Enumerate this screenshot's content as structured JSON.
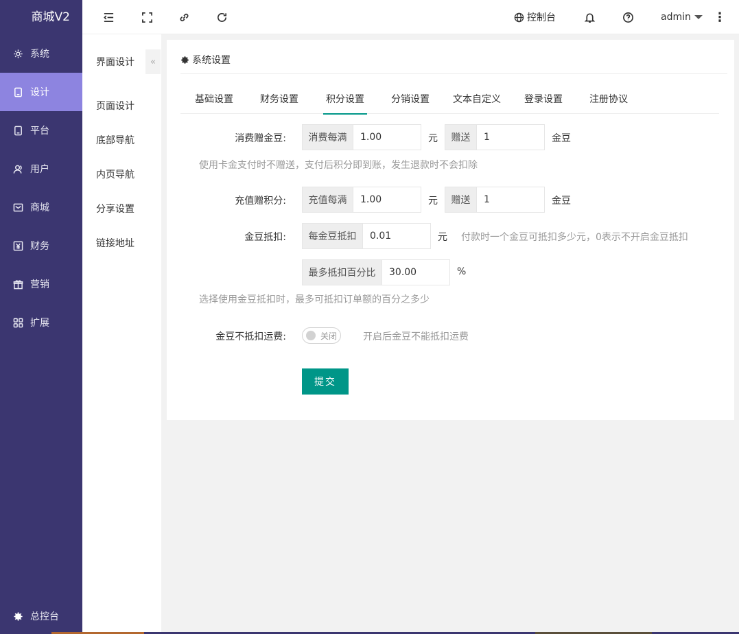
{
  "app": {
    "title": "商城V2"
  },
  "sidebar": {
    "items": [
      {
        "label": "系统",
        "icon": "gear-icon"
      },
      {
        "label": "设计",
        "icon": "tablet-icon",
        "active": true
      },
      {
        "label": "平台",
        "icon": "tablet-icon"
      },
      {
        "label": "用户",
        "icon": "user-icon"
      },
      {
        "label": "商城",
        "icon": "mail-icon"
      },
      {
        "label": "财务",
        "icon": "yen-icon"
      },
      {
        "label": "营销",
        "icon": "gift-icon"
      },
      {
        "label": "扩展",
        "icon": "grid-icon"
      }
    ],
    "bottom": {
      "label": "总控台",
      "icon": "gear-icon"
    }
  },
  "topbar": {
    "console_label": "控制台",
    "user_label": "admin"
  },
  "submenu": {
    "items": [
      "界面设计",
      "页面设计",
      "底部导航",
      "内页导航",
      "分享设置",
      "链接地址"
    ],
    "collapse_glyph": "«"
  },
  "card": {
    "title": "系统设置",
    "tabs": [
      "基础设置",
      "财务设置",
      "积分设置",
      "分销设置",
      "文本自定义",
      "登录设置",
      "注册协议"
    ],
    "active_tab": "积分设置"
  },
  "form": {
    "consume": {
      "label": "消费赠金豆:",
      "addon1": "消费每满",
      "value1": "1.00",
      "unit1": "元",
      "addon2": "赠送",
      "value2": "1",
      "unit2": "金豆",
      "help": "使用卡金支付时不赠送，支付后积分即到账，发生退款时不会扣除"
    },
    "recharge": {
      "label": "充值赠积分:",
      "addon1": "充值每满",
      "value1": "1.00",
      "unit1": "元",
      "addon2": "赠送",
      "value2": "1",
      "unit2": "金豆"
    },
    "deduct": {
      "label": "金豆抵扣:",
      "addon1": "每金豆抵扣",
      "value1": "0.01",
      "unit1": "元",
      "help1": "付款时一个金豆可抵扣多少元，0表示不开启金豆抵扣",
      "addon2": "最多抵扣百分比",
      "value2": "30.00",
      "unit2": "%",
      "help2": "选择使用金豆抵扣时，最多可抵扣订单额的百分之多少"
    },
    "freight": {
      "label": "金豆不抵扣运费:",
      "switch_text": "关闭",
      "switch_on": false,
      "help": "开启后金豆不能抵扣运费"
    },
    "submit_label": "提交"
  },
  "colors": {
    "sidebar_bg": "#3b3670",
    "sidebar_active": "#8d84e0",
    "primary": "#009688"
  }
}
